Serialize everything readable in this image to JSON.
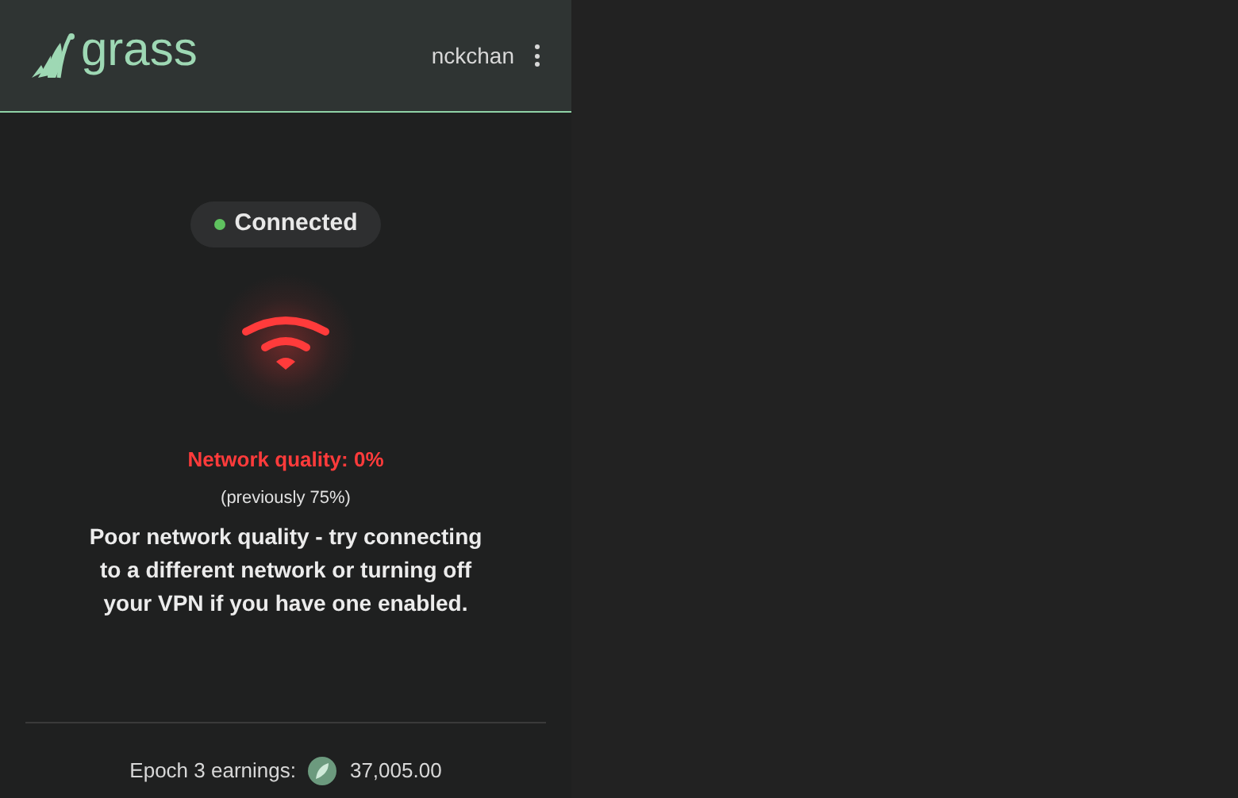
{
  "header": {
    "logo_text": "grass",
    "username": "nckchan"
  },
  "status": {
    "label": "Connected",
    "connected": true
  },
  "network": {
    "poor": true,
    "quality_label": "Network quality: 0%",
    "previous": "(previously 75%)",
    "message": "Poor network quality - try connecting to a different network or turning off your VPN if you have one enabled."
  },
  "earnings": {
    "label": "Epoch 3 earnings:",
    "amount": "37,005.00"
  }
}
